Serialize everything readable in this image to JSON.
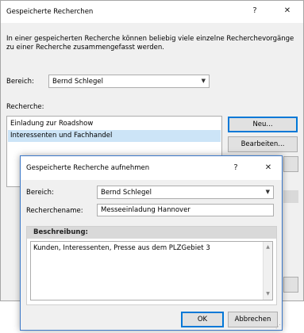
{
  "back_dialog": {
    "title": "Gespeicherte Recherchen",
    "help_glyph": "?",
    "close_glyph": "✕",
    "description": "In einer gespeicherten Recherche können beliebig viele einzelne Recherchevorgänge zu einer Recherche zusammengefasst werden.",
    "description_line1": "In einer gespeicherten Recherche können beliebig viele einzelne Recherchevorgänge",
    "description_line2": "zu einer Recherche zusammengefasst werden.",
    "bereich_label": "Bereich:",
    "bereich_value": "Bernd Schlegel",
    "recherche_label": "Recherche:",
    "recherche_items": [
      {
        "label": "Einladung zur Roadshow",
        "selected": false
      },
      {
        "label": "Interessenten und Fachhandel",
        "selected": true
      }
    ],
    "neu_button": "Neu...",
    "bearbeiten_button": "Bearbeiten..."
  },
  "front_dialog": {
    "title": "Gespeicherte Recherche aufnehmen",
    "help_glyph": "?",
    "close_glyph": "✕",
    "bereich_label": "Bereich:",
    "bereich_value": "Bernd Schlegel",
    "name_label": "Recherchename:",
    "name_value": "Messeeinladung Hannover",
    "beschreibung_label": "Beschreibung:",
    "beschreibung_value": "Kunden, Interessenten, Presse aus dem PLZGebiet 3",
    "ok_button": "OK",
    "cancel_button": "Abbrechen"
  },
  "icons": {
    "chevron": "chevron-down-icon",
    "help": "help-icon",
    "close": "close-icon",
    "scroll_up": "scroll-up-icon",
    "scroll_down": "scroll-down-icon",
    "grip": "resize-grip-icon"
  },
  "colors": {
    "selection": "#cce4f7",
    "default_button_border": "#0078d7",
    "dialog_border": "#3c78c8"
  }
}
